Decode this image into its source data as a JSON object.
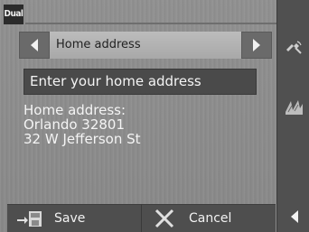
{
  "brand": {
    "logo_text": "Dual"
  },
  "header": {
    "title": "Home address"
  },
  "prompt": {
    "label": "Enter your home address"
  },
  "address": {
    "heading": "Home address:",
    "line1": "Orlando 32801",
    "line2": "32 W Jefferson St"
  },
  "footer": {
    "save_label": "Save",
    "cancel_label": "Cancel"
  },
  "sidebar": {
    "icons": [
      "satellite-icon",
      "map-icon"
    ]
  },
  "colors": {
    "panel": "#4a4a4a",
    "background": "#8c8c8c",
    "text": "#f4f4f4"
  }
}
